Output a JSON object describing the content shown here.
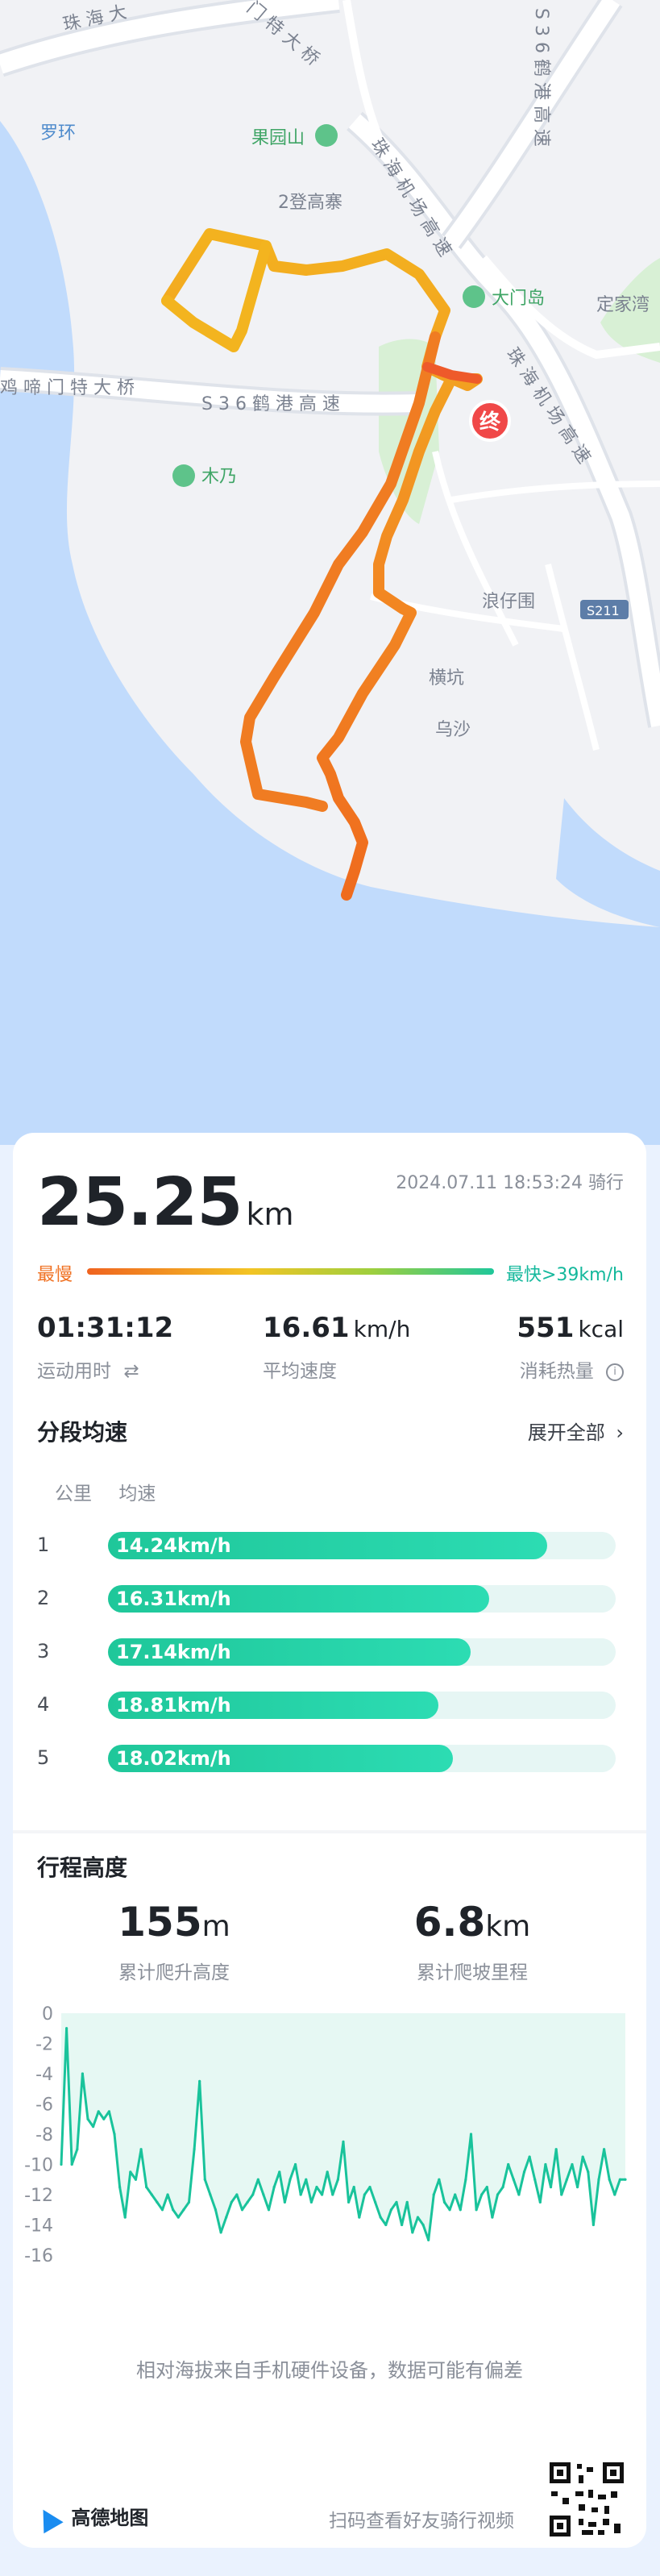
{
  "map": {
    "labels": {
      "zhuhai_bridge_top": "珠 海 大",
      "men_bridge": "门 特 大 桥",
      "he_gang_gaosu": "S 3 6 鹤 港 高 速",
      "luohuan": "罗环",
      "guoyuanshan": "果园山",
      "erdeng": "2登高寨",
      "jichang_gaosu_1": "珠 海 机 场 高 速",
      "jichang_gaosu_2": "珠 海 机 场 高 速",
      "he_gang_top": "S 3 6 鹤 港 高 速",
      "damendao": "大门岛",
      "dingjiawan": "定家湾",
      "yaqi_bridge": "鸡 啼 门 特 大 桥",
      "munai": "木乃",
      "end_marker": "终",
      "langzaiwei": "浪仔围",
      "s211": "S211",
      "hengkeng": "横坑",
      "wusha": "乌沙"
    },
    "colors": {
      "water": "#c1dbfc",
      "land": "#f1f2f5",
      "road": "#ffffff",
      "road_outline": "#d9dde3",
      "green": "#d8f0d5",
      "route_slow": "#f28624",
      "route_fast": "#f5c423",
      "end_marker": "#f04848"
    }
  },
  "summary": {
    "distance_value": "25.25",
    "distance_unit": "km",
    "datetime": "2024.07.11 18:53:24",
    "activity": "骑行",
    "slowest_label": "最慢",
    "fastest_label": "最快>39km/h",
    "duration_value": "01:31:12",
    "duration_label": "运动用时",
    "avg_speed_value": "16.61",
    "avg_speed_unit": "km/h",
    "avg_speed_label": "平均速度",
    "calories_value": "551",
    "calories_unit": "kcal",
    "calories_label": "消耗热量"
  },
  "segments": {
    "title": "分段均速",
    "expand_label": "展开全部",
    "col_km": "公里",
    "col_speed": "均速",
    "rows": [
      {
        "km": "1",
        "speed": "14.24km/h",
        "fill": 0.865
      },
      {
        "km": "2",
        "speed": "16.31km/h",
        "fill": 0.75
      },
      {
        "km": "3",
        "speed": "17.14km/h",
        "fill": 0.715
      },
      {
        "km": "4",
        "speed": "18.81km/h",
        "fill": 0.65
      },
      {
        "km": "5",
        "speed": "18.02km/h",
        "fill": 0.68
      }
    ]
  },
  "elevation": {
    "title": "行程高度",
    "climb_value": "155",
    "climb_unit": "m",
    "climb_label": "累计爬升高度",
    "climb_distance_value": "6.8",
    "climb_distance_unit": "km",
    "climb_distance_label": "累计爬坡里程",
    "note": "相对海拔来自手机硬件设备，数据可能有偏差"
  },
  "chart_data": {
    "type": "area",
    "title": "",
    "xlabel": "",
    "ylabel": "",
    "ylim": [
      -16,
      0
    ],
    "yticks": [
      0,
      -2,
      -4,
      -6,
      -8,
      -10,
      -12,
      -14,
      -16
    ],
    "grid": false,
    "series": [
      {
        "values": [
          -10,
          -1,
          -10,
          -9,
          -4,
          -7,
          -7.5,
          -6.5,
          -7,
          -6.5,
          -8,
          -11.5,
          -13.5,
          -10.5,
          -11,
          -9,
          -11.5,
          -12,
          -12.5,
          -13,
          -12,
          -13,
          -13.5,
          -13,
          -12.5,
          -9,
          -4.5,
          -11,
          -12,
          -13,
          -14.5,
          -13.5,
          -12.5,
          -12,
          -13,
          -12.5,
          -12,
          -11,
          -12,
          -13,
          -11.5,
          -10.5,
          -12.5,
          -11,
          -10,
          -12,
          -11,
          -12.5,
          -11.5,
          -12,
          -10.5,
          -12,
          -11,
          -8.5,
          -12.5,
          -11.5,
          -13.5,
          -12,
          -11.5,
          -12.5,
          -13.5,
          -14,
          -13,
          -12.5,
          -14,
          -12.5,
          -14.5,
          -13.5,
          -14,
          -15,
          -12,
          -11,
          -12.5,
          -13,
          -12,
          -13,
          -11,
          -8,
          -13,
          -12,
          -11.5,
          -13.5,
          -12,
          -11.5,
          -10,
          -11,
          -12,
          -10.5,
          -9.5,
          -11,
          -12.5,
          -10,
          -11.5,
          -9,
          -12,
          -11,
          -10,
          -11.5,
          -9.5,
          -10.5,
          -14,
          -11,
          -9,
          -11,
          -12,
          -11,
          -11
        ]
      }
    ]
  },
  "footer": {
    "brand": "高德地图",
    "share_text": "扫码查看好友骑行视频"
  }
}
